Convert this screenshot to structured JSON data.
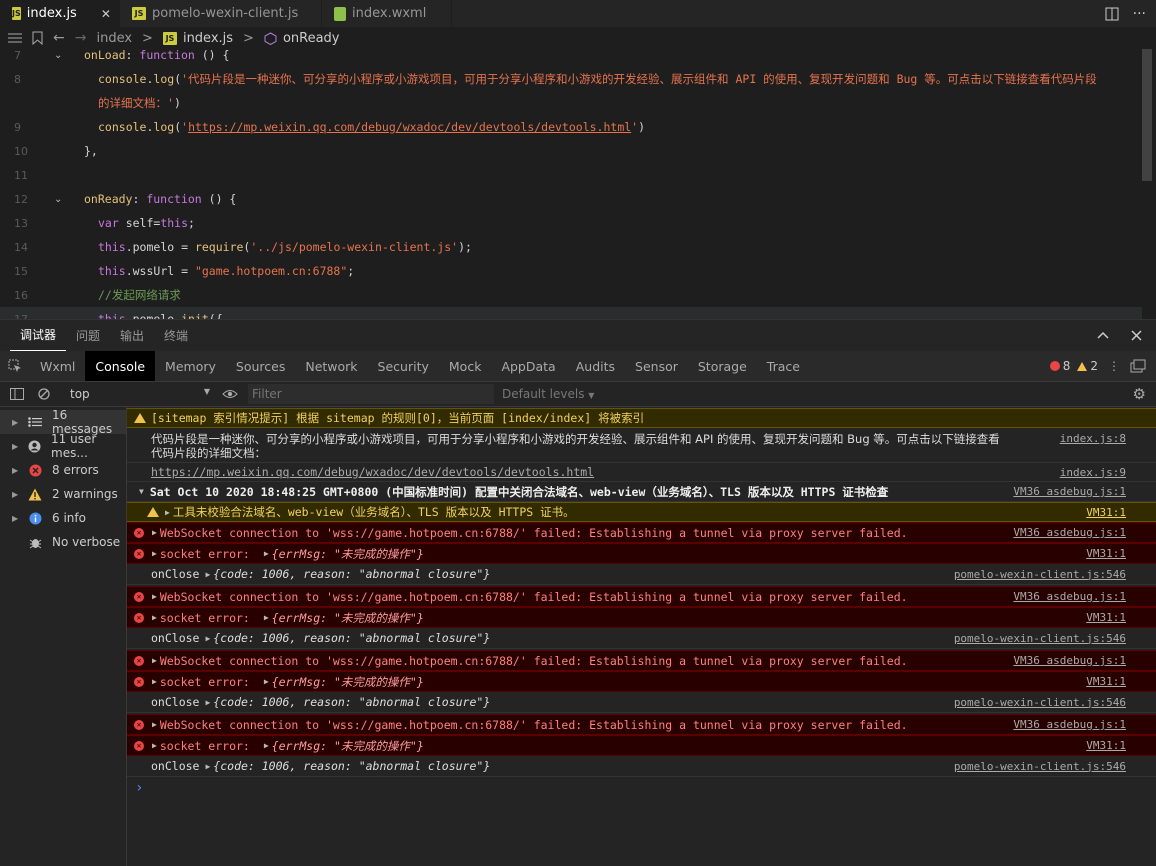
{
  "tabs": [
    {
      "label": "index.js",
      "badge": "JS",
      "active": true
    },
    {
      "label": "pomelo-wexin-client.js",
      "badge": "JS",
      "active": false
    },
    {
      "label": "index.wxml",
      "badge": "",
      "active": false
    }
  ],
  "breadcrumb": {
    "folder": "index",
    "sep": ">",
    "file": "index.js",
    "symbol": "onReady"
  },
  "editor": {
    "lines": [
      {
        "n": "7",
        "fold": true,
        "indent": 0,
        "html": "onLoad: function () {"
      },
      {
        "n": "8",
        "fold": false,
        "indent": 1,
        "html": "console.log('代码片段是一种迷你、可分享的小程序或小游戏项目，可用于分享小程序和小游戏的开发经验、展示组件和 API 的使用、复现开发问题和 Bug 等。可点击以下链接查看代码片段"
      },
      {
        "n": "",
        "fold": false,
        "indent": 1,
        "html": "的详细文档：')"
      },
      {
        "n": "9",
        "fold": false,
        "indent": 1,
        "html": "console.log('https://mp.weixin.qq.com/debug/wxadoc/dev/devtools/devtools.html')"
      },
      {
        "n": "10",
        "fold": false,
        "indent": 0,
        "html": "},"
      },
      {
        "n": "11",
        "fold": false,
        "indent": 0,
        "html": ""
      },
      {
        "n": "12",
        "fold": true,
        "indent": 0,
        "html": "onReady: function () {"
      },
      {
        "n": "13",
        "fold": false,
        "indent": 1,
        "html": "var self=this;"
      },
      {
        "n": "14",
        "fold": false,
        "indent": 1,
        "html": "this.pomelo = require('../js/pomelo-wexin-client.js');"
      },
      {
        "n": "15",
        "fold": false,
        "indent": 1,
        "html": "this.wssUrl = \"game.hotpoem.cn:6788\";"
      },
      {
        "n": "16",
        "fold": false,
        "indent": 1,
        "html": "//发起网络请求"
      },
      {
        "n": "17",
        "fold": true,
        "indent": 1,
        "html": "this.pomelo.init({"
      }
    ]
  },
  "panel": {
    "tabs": [
      "调试器",
      "问题",
      "输出",
      "终端"
    ],
    "active_tab": "调试器"
  },
  "devtools": {
    "tabs": [
      "Wxml",
      "Console",
      "Memory",
      "Sources",
      "Network",
      "Security",
      "Mock",
      "AppData",
      "Audits",
      "Sensor",
      "Storage",
      "Trace"
    ],
    "active": "Console",
    "error_count": "8",
    "warning_count": "2"
  },
  "filter": {
    "context": "top",
    "placeholder": "Filter",
    "levels": "Default levels"
  },
  "sidebar": {
    "items": [
      {
        "label": "16 messages",
        "icon": "list-icon"
      },
      {
        "label": "11 user mes...",
        "icon": "user-icon"
      },
      {
        "label": "8 errors",
        "icon": "error-icon"
      },
      {
        "label": "2 warnings",
        "icon": "warning-icon"
      },
      {
        "label": "6 info",
        "icon": "info-icon"
      },
      {
        "label": "No verbose",
        "icon": "bug-icon"
      }
    ]
  },
  "console": {
    "messages": [
      {
        "type": "warn",
        "text": "[sitemap 索引情况提示] 根据 sitemap 的规则[0]，当前页面 [index/index] 将被索引",
        "src": ""
      },
      {
        "type": "log",
        "text": "代码片段是一种迷你、可分享的小程序或小游戏项目，可用于分享小程序和小游戏的开发经验、展示组件和 API 的使用、复现开发问题和 Bug 等。可点击以下链接查看",
        "text2": "代码片段的详细文档：",
        "src": "index.js:8"
      },
      {
        "type": "log",
        "text": "https://mp.weixin.qq.com/debug/wxadoc/dev/devtools/devtools.html",
        "src": "index.js:9"
      },
      {
        "type": "group",
        "text": "Sat Oct 10 2020 18:48:25 GMT+0800 (中国标准时间) 配置中关闭合法域名、web-view（业务域名）、TLS 版本以及 HTTPS 证书检查",
        "src": "VM36 asdebug.js:1"
      },
      {
        "type": "warn",
        "text": "工具未校验合法域名、web-view（业务域名）、TLS 版本以及 HTTPS 证书。",
        "src": "VM31:1"
      },
      {
        "type": "err",
        "text": "WebSocket connection to 'wss://game.hotpoem.cn:6788/' failed: Establishing a tunnel via proxy server failed.",
        "src": "VM36 asdebug.js:1"
      },
      {
        "type": "err",
        "text": "socket error:",
        "obj": "{errMsg: \"未完成的操作\"}",
        "src": "VM31:1"
      },
      {
        "type": "log",
        "text": "onClose",
        "obj": "{code: 1006, reason: \"abnormal closure\"}",
        "src": "pomelo-wexin-client.js:546"
      },
      {
        "type": "err",
        "text": "WebSocket connection to 'wss://game.hotpoem.cn:6788/' failed: Establishing a tunnel via proxy server failed.",
        "src": "VM36 asdebug.js:1"
      },
      {
        "type": "err",
        "text": "socket error:",
        "obj": "{errMsg: \"未完成的操作\"}",
        "src": "VM31:1"
      },
      {
        "type": "log",
        "text": "onClose",
        "obj": "{code: 1006, reason: \"abnormal closure\"}",
        "src": "pomelo-wexin-client.js:546"
      },
      {
        "type": "err",
        "text": "WebSocket connection to 'wss://game.hotpoem.cn:6788/' failed: Establishing a tunnel via proxy server failed.",
        "src": "VM36 asdebug.js:1"
      },
      {
        "type": "err",
        "text": "socket error:",
        "obj": "{errMsg: \"未完成的操作\"}",
        "src": "VM31:1"
      },
      {
        "type": "log",
        "text": "onClose",
        "obj": "{code: 1006, reason: \"abnormal closure\"}",
        "src": "pomelo-wexin-client.js:546"
      },
      {
        "type": "err",
        "text": "WebSocket connection to 'wss://game.hotpoem.cn:6788/' failed: Establishing a tunnel via proxy server failed.",
        "src": "VM36 asdebug.js:1"
      },
      {
        "type": "err",
        "text": "socket error:",
        "obj": "{errMsg: \"未完成的操作\"}",
        "src": "VM31:1"
      },
      {
        "type": "log",
        "text": "onClose",
        "obj": "{code: 1006, reason: \"abnormal closure\"}",
        "src": "pomelo-wexin-client.js:546"
      }
    ],
    "prompt": "›"
  }
}
